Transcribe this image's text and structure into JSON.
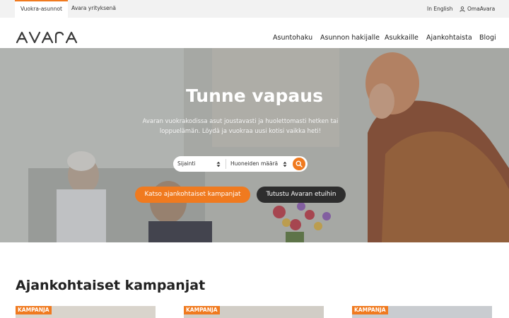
{
  "utility": {
    "tab_active": "Vuokra-asunnot",
    "tab_second": "Avara yrityksenä",
    "language": "In English",
    "account": "OmaAvara"
  },
  "brand": {
    "logo_text": "AVARA",
    "accent_color": "#f07a1f",
    "dark_color": "#2d2d2d"
  },
  "nav": {
    "items": [
      "Asuntohaku",
      "Asunnon hakijalle",
      "Asukkaille",
      "Ajankohtaista",
      "Blogi"
    ]
  },
  "hero": {
    "title": "Tunne vapaus",
    "subtitle": "Avaran vuokrakodissa asut joustavasti ja huolettomasti hetken tai loppuelämän. Löydä ja vuokraa uusi kotisi vaikka heti!",
    "location_select": "Sijainti",
    "rooms_select": "Huoneiden määrä",
    "search_icon": "search-icon",
    "cta_primary": "Katso ajankohtaiset kampanjat",
    "cta_secondary": "Tutustu Avaran etuihin"
  },
  "campaigns": {
    "title": "Ajankohtaiset kampanjat",
    "cards": [
      {
        "badge": "KAMPANJA"
      },
      {
        "badge": "KAMPANJA"
      },
      {
        "badge": "KAMPANJA"
      }
    ]
  }
}
